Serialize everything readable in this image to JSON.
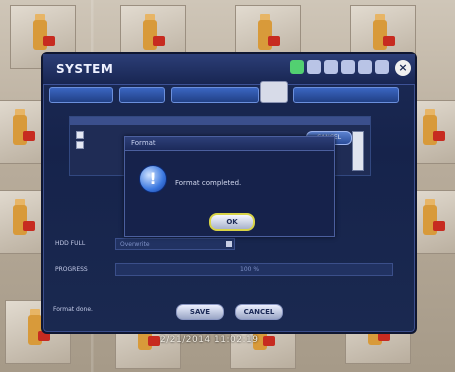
{
  "window": {
    "title": "SYSTEM",
    "close_glyph": "×",
    "icons": [
      "network-icon",
      "device-icon",
      "record-icon",
      "event-icon",
      "backup-icon",
      "system-icon"
    ]
  },
  "panel": {
    "progress_label": "PROGRESS",
    "progress_value": "100 %",
    "hdd_label": "HDD FULL",
    "hdd_value": "Overwrite",
    "status_text": "Format done."
  },
  "dialog": {
    "title": "Format",
    "message": "Format completed.",
    "ok_label": "OK"
  },
  "side_cancel_label": "CANCEL",
  "footer": {
    "save_label": "SAVE",
    "cancel_label": "CANCEL"
  },
  "clock": "2/21/2014 11:02:19"
}
